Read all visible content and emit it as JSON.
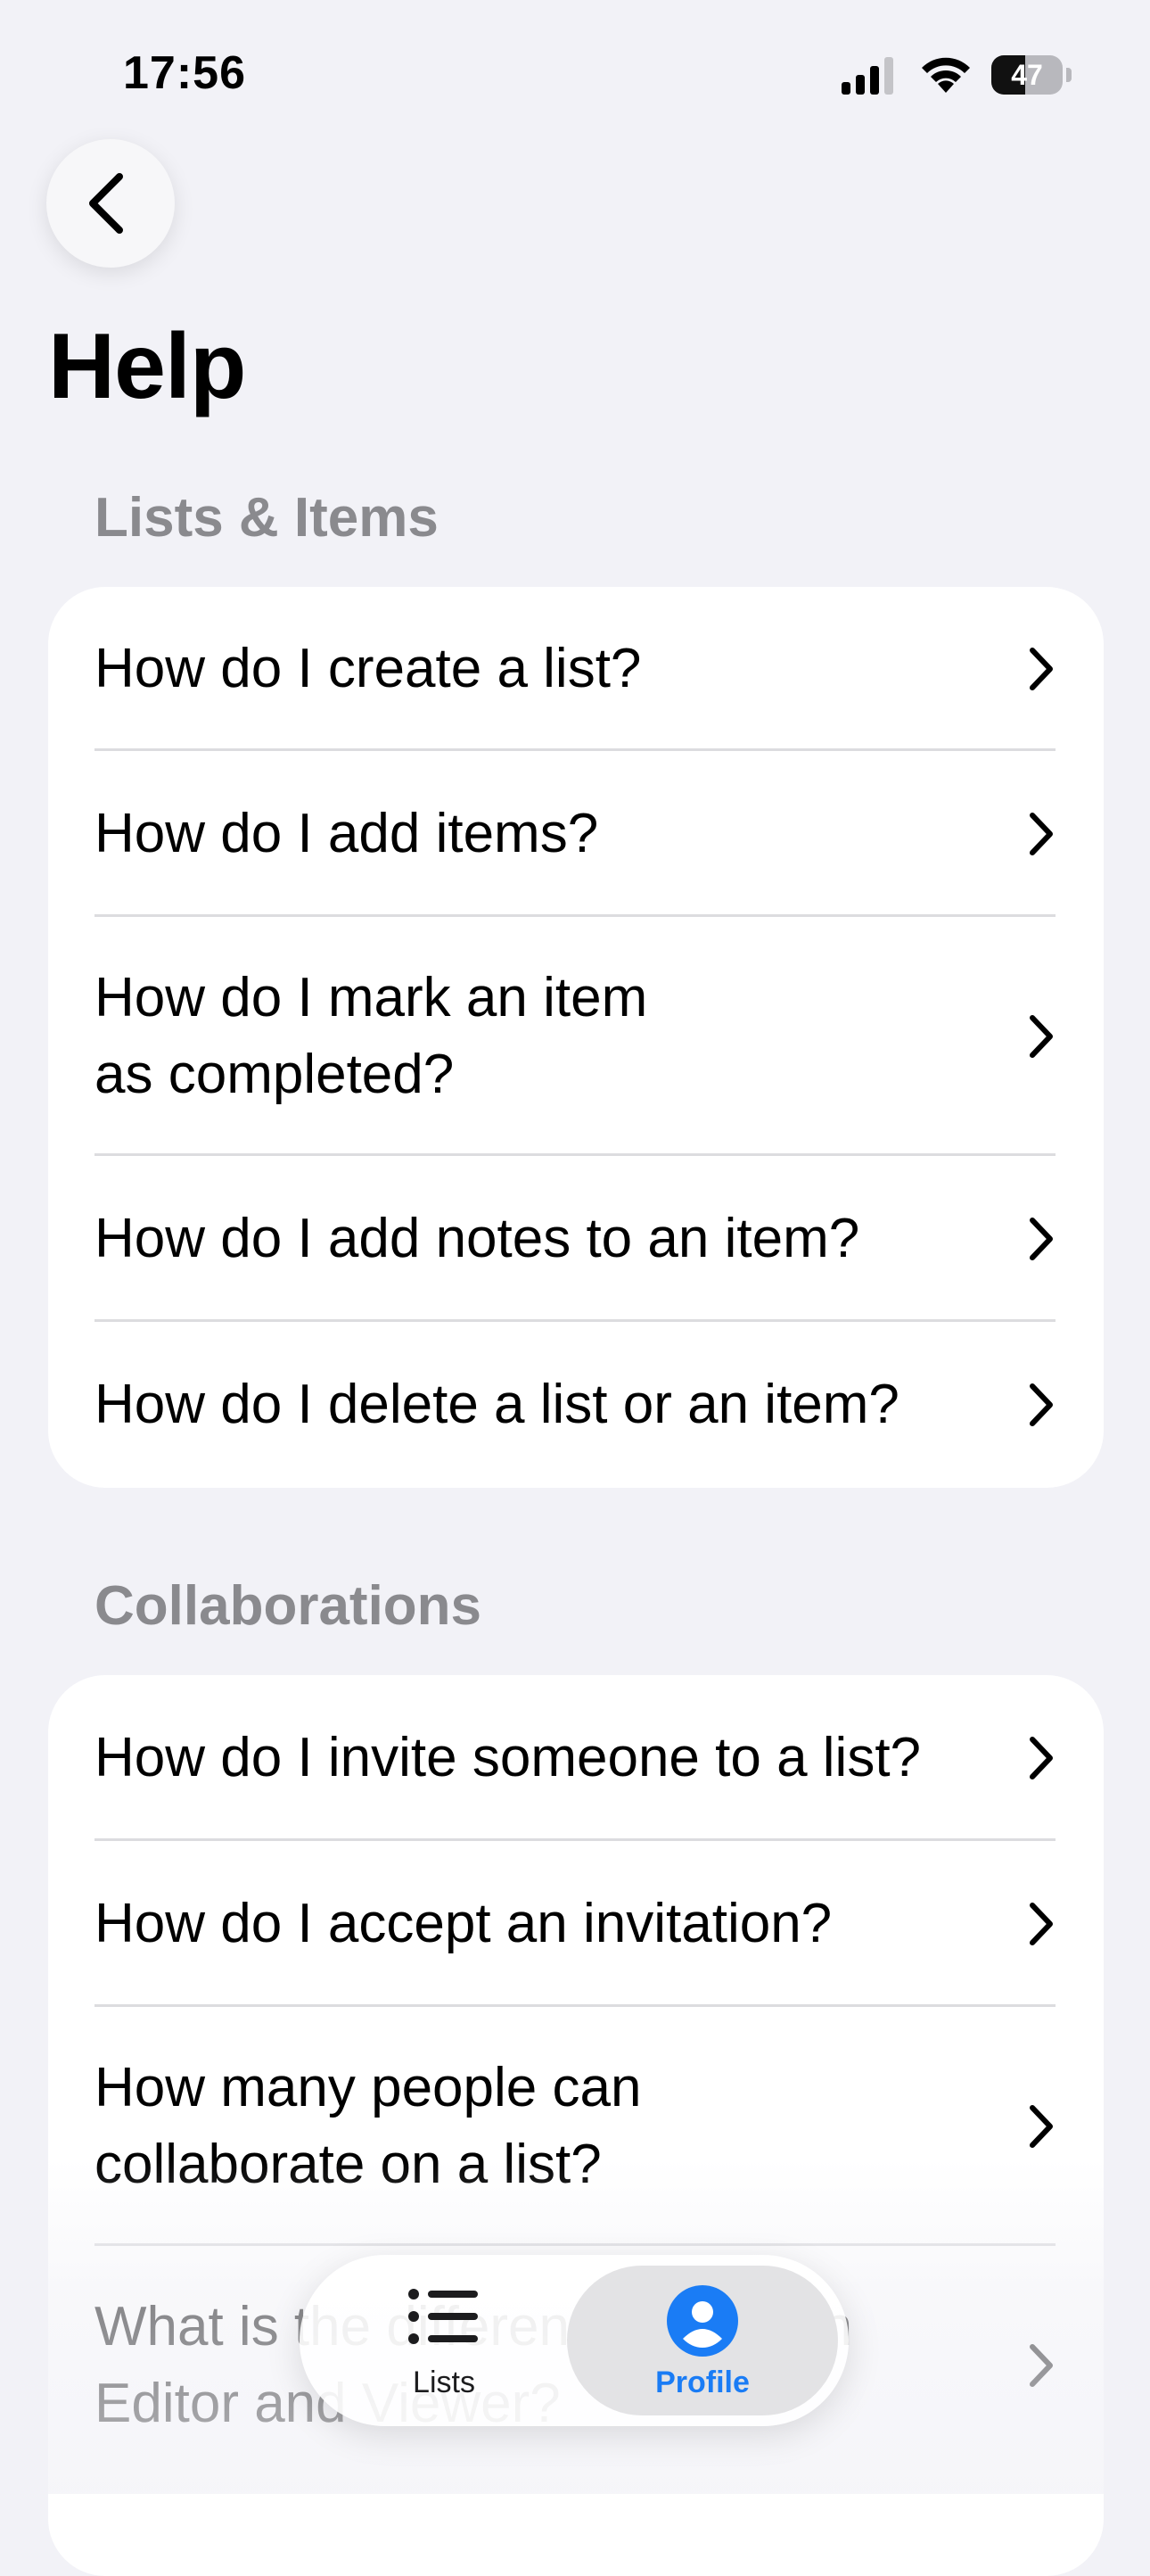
{
  "status_bar": {
    "time": "17:56",
    "battery_level": "47",
    "battery_percent": 47
  },
  "nav": {
    "back_icon": "chevron-left-icon",
    "title": "Help"
  },
  "sections": [
    {
      "header": "Lists & Items",
      "items": [
        {
          "line1": "How do I create a list?"
        },
        {
          "line1": "How do I add items?"
        },
        {
          "line1": "How do I mark an item",
          "line2": "as completed?"
        },
        {
          "line1": "How do I add notes to an item?"
        },
        {
          "line1": "How do I delete a list or an item?"
        }
      ]
    },
    {
      "header": "Collaborations",
      "items": [
        {
          "line1": "How do I invite someone to a list?"
        },
        {
          "line1": "How do I accept an invitation?"
        },
        {
          "line1": "How many people can",
          "line2": "collaborate on a list?"
        },
        {
          "line1": "What is the difference between",
          "line2": "Editor and Viewer?"
        }
      ]
    }
  ],
  "tab_bar": {
    "tabs": [
      {
        "label": "Lists",
        "icon": "list-icon",
        "selected": false
      },
      {
        "label": "Profile",
        "icon": "person-circle-icon",
        "selected": true
      }
    ]
  },
  "colors": {
    "background": "#f2f2f7",
    "card": "#ffffff",
    "section_header": "#8a8a8e",
    "accent": "#1a7cf5"
  }
}
